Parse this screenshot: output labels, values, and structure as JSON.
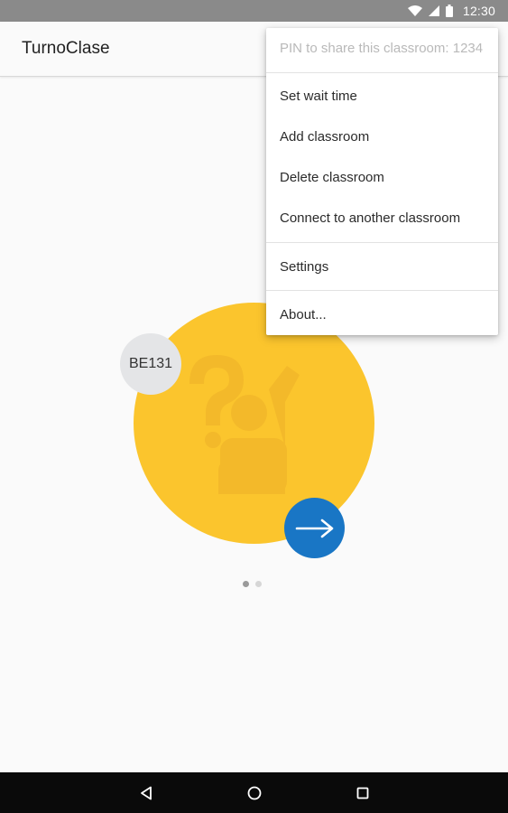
{
  "status_bar": {
    "time": "12:30"
  },
  "app_bar": {
    "title": "TurnoClase"
  },
  "classroom": {
    "badge": "BE131",
    "colors": {
      "primary_circle": "#fbc52d",
      "accent_circle": "#e0452f",
      "next_button": "#1976c5"
    }
  },
  "pager": {
    "pages": 2,
    "active": 1
  },
  "menu": {
    "header": "PIN to share this classroom: 1234",
    "items": [
      {
        "label": "Set wait time"
      },
      {
        "label": "Add classroom"
      },
      {
        "label": "Delete classroom"
      },
      {
        "label": "Connect to another classroom"
      },
      {
        "label": "Settings"
      },
      {
        "label": "About..."
      }
    ]
  },
  "icons": {
    "status": [
      "wifi-icon",
      "signal-icon",
      "battery-icon"
    ],
    "next_button": "arrow-right-icon",
    "nav": [
      "back-icon",
      "home-icon",
      "recents-icon"
    ]
  }
}
